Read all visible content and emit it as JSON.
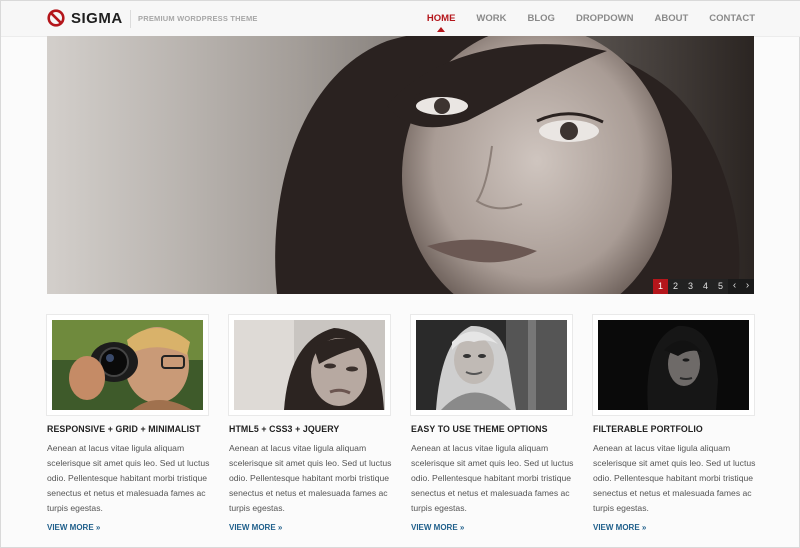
{
  "header": {
    "brand": "SIGMA",
    "tagline": "PREMIUM WORDPRESS THEME",
    "nav": [
      {
        "label": "HOME",
        "active": true
      },
      {
        "label": "WORK",
        "active": false
      },
      {
        "label": "BLOG",
        "active": false
      },
      {
        "label": "DROPDOWN",
        "active": false
      },
      {
        "label": "ABOUT",
        "active": false
      },
      {
        "label": "CONTACT",
        "active": false
      }
    ]
  },
  "slider": {
    "pages": [
      "1",
      "2",
      "3",
      "4",
      "5"
    ],
    "active_page": "1",
    "prev_icon": "‹",
    "next_icon": "›"
  },
  "features": [
    {
      "title": "RESPONSIVE + GRID + MINIMALIST",
      "body": "Aenean at lacus vitae ligula aliquam scelerisque sit amet quis leo. Sed ut luctus odio. Pellentesque habitant morbi tristique senectus et netus et malesuada fames ac turpis egestas.",
      "link": "VIEW MORE »"
    },
    {
      "title": "HTML5 + CSS3 + JQUERY",
      "body": "Aenean at lacus vitae ligula aliquam scelerisque sit amet quis leo. Sed ut luctus odio. Pellentesque habitant morbi tristique senectus et netus et malesuada fames ac turpis egestas.",
      "link": "VIEW MORE »"
    },
    {
      "title": "EASY TO USE THEME OPTIONS",
      "body": "Aenean at lacus vitae ligula aliquam scelerisque sit amet quis leo. Sed ut luctus odio. Pellentesque habitant morbi tristique senectus et netus et malesuada fames ac turpis egestas.",
      "link": "VIEW MORE »"
    },
    {
      "title": "FILTERABLE PORTFOLIO",
      "body": "Aenean at lacus vitae ligula aliquam scelerisque sit amet quis leo. Sed ut luctus odio. Pellentesque habitant morbi tristique senectus et netus et malesuada fames ac turpis egestas.",
      "link": "VIEW MORE »"
    }
  ],
  "colors": {
    "accent": "#b4161b",
    "link": "#1f5f8b"
  }
}
